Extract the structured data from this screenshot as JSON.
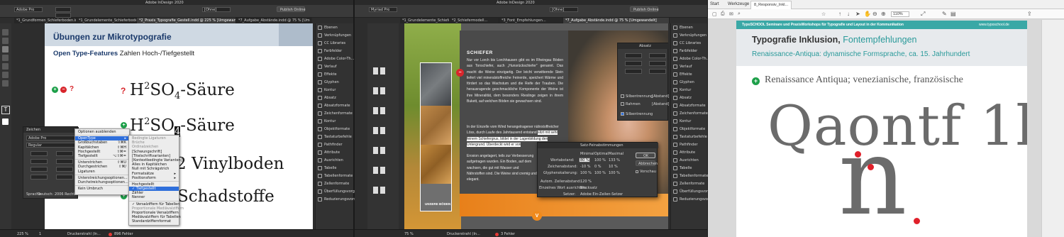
{
  "colors": {
    "app_dark": "#2d2d2d",
    "panel": "#3a3a3a",
    "accent_green": "#1ea04a",
    "accent_red": "#d8262c",
    "teal": "#2a9a9a",
    "navy": "#1b3a6b",
    "orange": "#f08a1c",
    "slide_grey": "#6b6b6b"
  },
  "app": {
    "title": "Adobe InDesign 2020",
    "publish_button": "Publish Online",
    "font_name": "Adobe Pro",
    "font_field_right": "Myriad Pro",
    "style_field": "[Ohne]",
    "tabs_left": [
      "*1_Grundformen_Schieferboden.indd @ 180 %",
      "*1_Grundelemente_Schieferboden...",
      "*2_Praxis_Typografie_Gestell.indd @ 225 % [Umgewandelt]",
      "*7_Aufgabe_Abstände.indd @ 75 % [Umgewandelt]"
    ],
    "tabs_middle": [
      "*1_Grundelemente_Schieferboden...",
      "*2_Schiefermodell...",
      "*3_Font_Empfehlungen...",
      "*7_Aufgabe_Abstände.indd @ 75 % [Umgewandelt]"
    ]
  },
  "doc1": {
    "heading": "Übungen zur Mikrotypografie",
    "subheading_bold": "Open Type-Features",
    "subheading_rest": " Zahlen Hoch-/Tiefgestellt",
    "question_mark": "?",
    "line1": {
      "pre": "H",
      "sup": "2",
      "mid": "SO",
      "sub": "4",
      "post": "-Säure"
    },
    "line2": {
      "pre": "H",
      "sup": "2",
      "mid": "SO",
      "sub": "4",
      "post": "-Säure"
    },
    "line3_tail": "2 Vinylboden",
    "line4_tail": "Schadstoffe"
  },
  "zeichen_panel": {
    "title": "Zeichen",
    "font": "Adobe Pro",
    "style": "Regular",
    "lang_label": "Sprache",
    "lang_value": "Deutsch: 2006 Rechtsch..."
  },
  "context_menu": {
    "items": [
      {
        "label": "Optionen ausblenden",
        "shortcut": ""
      },
      {
        "label": "OpenType",
        "shortcut": "▸",
        "selected": true
      },
      {
        "label": "Großbuchstaben",
        "shortcut": "⇧⌘K"
      },
      {
        "label": "Kapitälchen",
        "shortcut": "⇧⌘H"
      },
      {
        "label": "Hochgestellt",
        "shortcut": "⇧⌘="
      },
      {
        "label": "Tiefgestellt",
        "shortcut": "⌥⇧⌘="
      },
      {
        "label": "Unterstrichen",
        "shortcut": "⇧⌘U"
      },
      {
        "label": "Durchgestrichen",
        "shortcut": "⇧⌘/"
      },
      {
        "label": "Ligaturen",
        "shortcut": ""
      },
      {
        "label": "Unterstreichungsoptionen...",
        "shortcut": ""
      },
      {
        "label": "Durchstreichungsoptionen...",
        "shortcut": ""
      },
      {
        "label": "Kein Umbruch",
        "shortcut": ""
      }
    ]
  },
  "submenu": {
    "items": [
      {
        "label": "Bedingte Ligaturen"
      },
      {
        "label": "Brüche"
      },
      {
        "label": "Ordinalzeichen"
      },
      {
        "label": "[Schwungschrift]"
      },
      {
        "label": "[Titelschriftvarianten]"
      },
      {
        "label": "[Kontextbedingte Varianten]"
      },
      {
        "label": "Alles in Kapitälchen"
      },
      {
        "label": "Null mit Schrägstrich"
      },
      {
        "label": "Formatsätze",
        "arrow": "▸"
      },
      {
        "label": "Positionsform",
        "arrow": "▸"
      },
      {
        "label": "Hochgestellt"
      },
      {
        "label": "✓ Tiefgestellt",
        "selected": true
      },
      {
        "label": "Zähler"
      },
      {
        "label": "Nenner"
      },
      {
        "label": "✓ Versalziffern für Tabellen"
      },
      {
        "label": "Proportionale Mediävalziffern"
      },
      {
        "label": "Proportionale Versalziffern"
      },
      {
        "label": "Mediävalziffern für Tabellen"
      },
      {
        "label": "Standardziffernformat"
      }
    ]
  },
  "right_panel_items": [
    "Ebenen",
    "Verknüpfungen",
    "CC Libraries",
    "Farbfelder",
    "Adobe Color-Th...",
    "Verlauf",
    "Effekte",
    "Glyphen",
    "Kontur",
    "Absatz",
    "Absatzformate",
    "Zeichenformate",
    "Kontur",
    "Objektformate",
    "Tastaturbefehle",
    "Pathfinder",
    "Attribute",
    "Ausrichten",
    "Tabelle",
    "Tabellenformate",
    "Zellenformate",
    "Überfüllungsvorgaben",
    "Reduzierungsvorschau"
  ],
  "statusbar": {
    "zoom": "225 %",
    "page": "1",
    "profile": "Druckerstrahl (In...",
    "errors": "896 Fehler",
    "errors_mid": "3 Fehler",
    "zoom_mid": "75 %"
  },
  "doc2": {
    "section_title": "SCHIEFER",
    "body1": "Nur vor Lorch bis Lorchhausen gibt es im Rheingau Böden aus Tonschiefer, auch „Hunsrückschiefer“ genannt. Das macht die Weine einzigartig. Der leicht verwitternde Stein liefert viel mineralstoffreiche Feinerde, speichert Wärme und fördert so das Wachstum und die Reife der Trauben. Die herausragende geschmackliche Komponente der Weine ist ihre Mineralität, dem besonders Rieslinge zeigen in ihrem Bukett, auf welchen Böden sie gewachsen sind.",
    "body2": "In der Einzelle vom Wind herangetragener nährstoffreicher Löss, durch Laufe des Jahrtausend entstand",
    "body2_highlight": "sitzt mit sehr feinem Schiefergrus, bildet in der Lagenbildung den Untergrund. Überdeckt wird er von",
    "body3": "Erosion angelagert, teils zur Verbesserung aufgetragen wurden. Ein Boden, auf dem wachsen, die gut mit Wasser und Nährstoffen sind. Die Weine sind cremig und elegant.",
    "photo_label": "UNSERE BÖDEN",
    "page_marker": "V"
  },
  "absatz_panel": {
    "title": "Absatz",
    "opt1": "Silbentrennung",
    "opt2": "Rahmen",
    "opt3": "Silbentrennung",
    "val1": "[Abstand]",
    "val2": "[Abstand]"
  },
  "dialog": {
    "title": "Satz-Feinabstimmungen",
    "col_min": "Minimal",
    "col_opt": "Optimal",
    "col_max": "Maximal",
    "row1_label": "Wortabstand:",
    "row1": [
      "80 %",
      "100 %",
      "133 %"
    ],
    "row2_label": "Zeichenabstand:",
    "row2": [
      "-10 %",
      "0 %",
      "10 %"
    ],
    "row3_label": "Glyphenskalierung:",
    "row3": [
      "100 %",
      "100 %",
      "100 %"
    ],
    "autozeilen_label": "Autom. Zeilenabstand:",
    "autozeilen_value": "120 %",
    "einzelwort_label": "Einzelnes Wort ausrichten:",
    "einzelwort_value": "Blocksatz",
    "setzer_label": "Setzer:",
    "setzer_value": "Adobe Ein-Zeilen-Setzer",
    "ok": "OK",
    "cancel": "Abbrechen",
    "preview": "Vorschau"
  },
  "acrobat": {
    "tab_start": "Start",
    "tab_tools": "Werkzeuge",
    "tab_doc": "8_Responsiv_Inkl...",
    "page_info": "1",
    "zoom": "110%"
  },
  "slide": {
    "banner_left": "TypoSCHOOL Seminare und PraxisWorkshops für Typografie und Layout in der Kommunikation",
    "banner_right": "www.typoschool.de",
    "title_bold": "Typografie Inklusion, ",
    "title_accent": "Fontempfehlungen",
    "subtitle": "Renaissance-Antiqua: dynamische Formsprache, ca. 15. Jahrhundert",
    "bullet": "Renaissance Antiqua; venezianische, französische",
    "big_text": "Qaontf 1lI",
    "big_letter": "n"
  }
}
